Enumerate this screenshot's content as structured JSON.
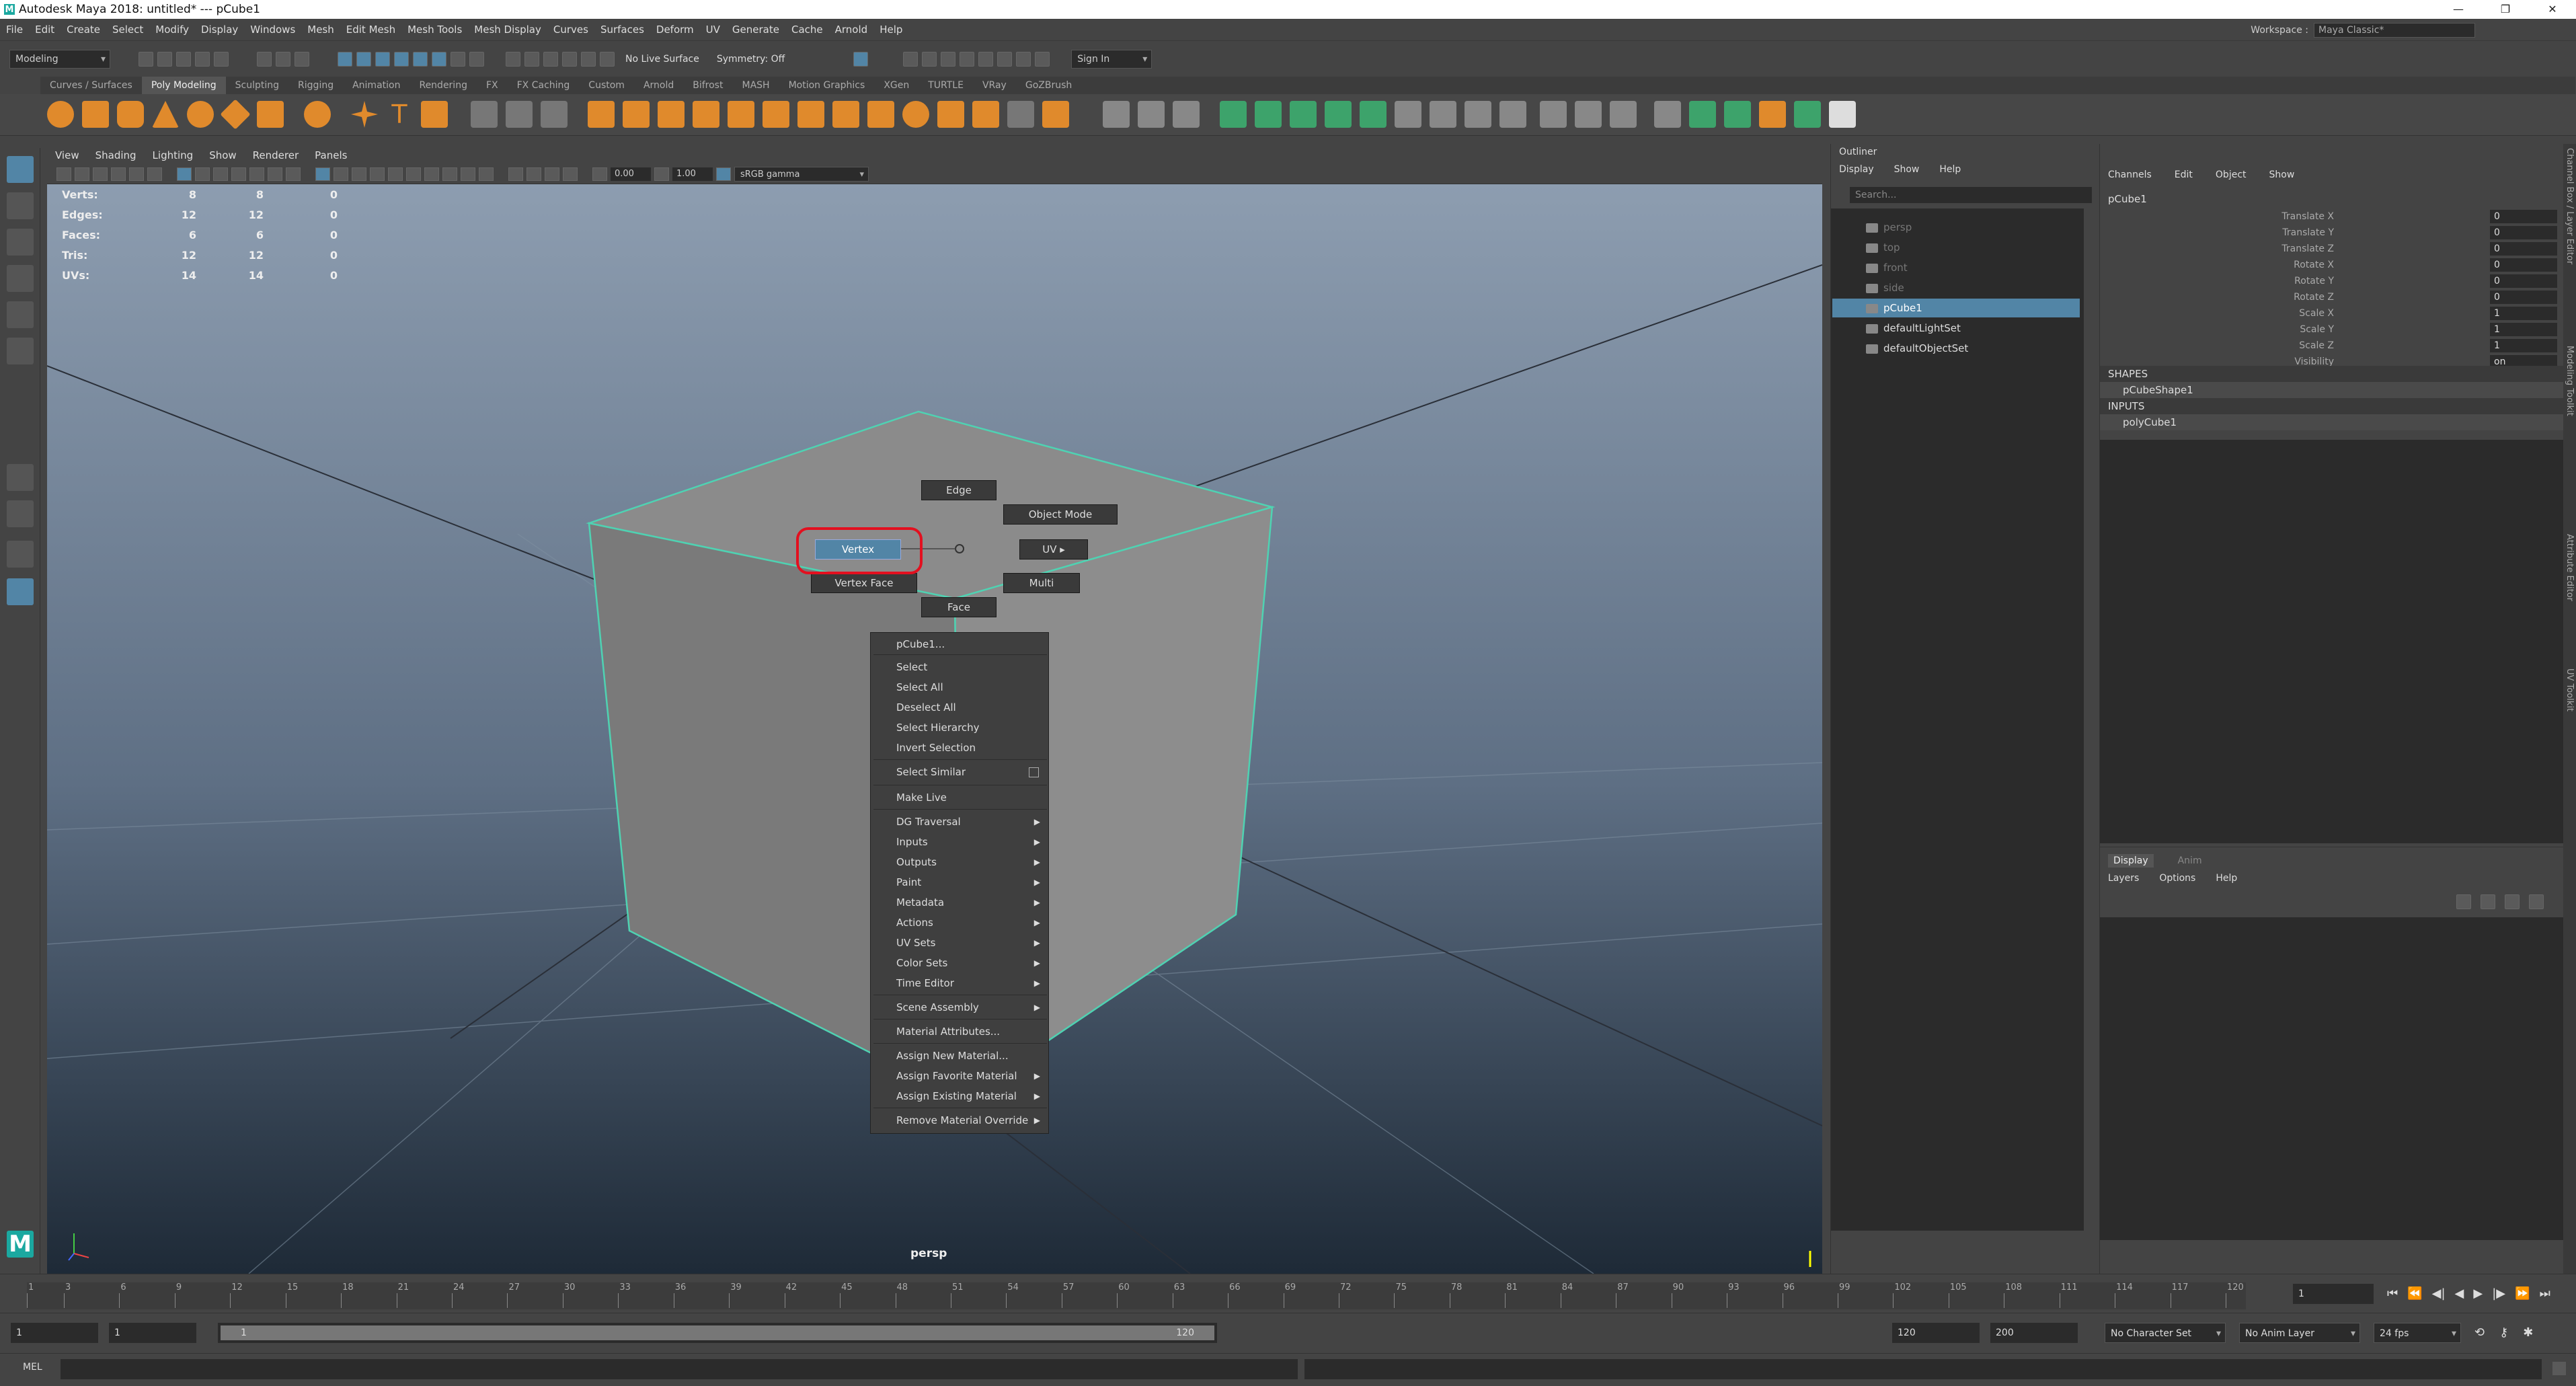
{
  "titlebar": {
    "title": "Autodesk Maya 2018: untitled*  ---  pCube1"
  },
  "menubar": {
    "items": [
      "File",
      "Edit",
      "Create",
      "Select",
      "Modify",
      "Display",
      "Windows",
      "Mesh",
      "Edit Mesh",
      "Mesh Tools",
      "Mesh Display",
      "Curves",
      "Surfaces",
      "Deform",
      "UV",
      "Generate",
      "Cache",
      "Arnold",
      "Help"
    ]
  },
  "workspace": {
    "label": "Workspace :",
    "value": "Maya Classic*"
  },
  "statusline": {
    "mode": "Modeling",
    "live_surface": "No Live Surface",
    "symmetry": "Symmetry: Off",
    "signin": "Sign In"
  },
  "shelf": {
    "tabs": [
      "Curves / Surfaces",
      "Poly Modeling",
      "Sculpting",
      "Rigging",
      "Animation",
      "Rendering",
      "FX",
      "FX Caching",
      "Custom",
      "Arnold",
      "Bifrost",
      "MASH",
      "Motion Graphics",
      "XGen",
      "TURTLE",
      "VRay",
      "GoZBrush"
    ],
    "active": "Poly Modeling"
  },
  "viewport": {
    "menu": [
      "View",
      "Shading",
      "Lighting",
      "Show",
      "Renderer",
      "Panels"
    ],
    "exposure": "0.00",
    "gamma_value": "1.00",
    "colorspace": "sRGB gamma",
    "camera_label": "persp",
    "hud": [
      {
        "label": "Verts:",
        "a": "8",
        "b": "8",
        "c": "0"
      },
      {
        "label": "Edges:",
        "a": "12",
        "b": "12",
        "c": "0"
      },
      {
        "label": "Faces:",
        "a": "6",
        "b": "6",
        "c": "0"
      },
      {
        "label": "Tris:",
        "a": "12",
        "b": "12",
        "c": "0"
      },
      {
        "label": "UVs:",
        "a": "14",
        "b": "14",
        "c": "0"
      }
    ]
  },
  "marking_menu": {
    "edge": "Edge",
    "object_mode": "Object Mode",
    "vertex": "Vertex",
    "uv": "UV",
    "vertex_face": "Vertex Face",
    "multi": "Multi",
    "face": "Face"
  },
  "context_menu": {
    "items": [
      {
        "label": "pCube1...",
        "sub": false
      },
      {
        "label": "Select",
        "sub": false
      },
      {
        "label": "Select All",
        "sub": false
      },
      {
        "label": "Deselect All",
        "sub": false
      },
      {
        "label": "Select Hierarchy",
        "sub": false
      },
      {
        "label": "Invert Selection",
        "sub": false
      },
      {
        "label": "Select Similar",
        "sub": false
      },
      {
        "label": "Make Live",
        "sub": false
      },
      {
        "label": "DG Traversal",
        "sub": true
      },
      {
        "label": "Inputs",
        "sub": true
      },
      {
        "label": "Outputs",
        "sub": true
      },
      {
        "label": "Paint",
        "sub": true
      },
      {
        "label": "Metadata",
        "sub": true
      },
      {
        "label": "Actions",
        "sub": true
      },
      {
        "label": "UV Sets",
        "sub": true
      },
      {
        "label": "Color Sets",
        "sub": true
      },
      {
        "label": "Time Editor",
        "sub": true
      },
      {
        "label": "Scene Assembly",
        "sub": true
      },
      {
        "label": "Material Attributes...",
        "sub": false
      },
      {
        "label": "Assign New Material...",
        "sub": false
      },
      {
        "label": "Assign Favorite Material",
        "sub": true
      },
      {
        "label": "Assign Existing Material",
        "sub": true
      },
      {
        "label": "Remove Material Override",
        "sub": true
      }
    ]
  },
  "outliner": {
    "title": "Outliner",
    "menu": [
      "Display",
      "Show",
      "Help"
    ],
    "search_placeholder": "Search...",
    "items": [
      {
        "label": "persp",
        "state": "dim"
      },
      {
        "label": "top",
        "state": "dim"
      },
      {
        "label": "front",
        "state": "dim"
      },
      {
        "label": "side",
        "state": "dim"
      },
      {
        "label": "pCube1",
        "state": "selected"
      },
      {
        "label": "defaultLightSet",
        "state": "normal"
      },
      {
        "label": "defaultObjectSet",
        "state": "normal"
      }
    ]
  },
  "channel_box": {
    "menu": [
      "Channels",
      "Edit",
      "Object",
      "Show"
    ],
    "object": "pCube1",
    "attrs": [
      {
        "label": "Translate X",
        "value": "0"
      },
      {
        "label": "Translate Y",
        "value": "0"
      },
      {
        "label": "Translate Z",
        "value": "0"
      },
      {
        "label": "Rotate X",
        "value": "0"
      },
      {
        "label": "Rotate Y",
        "value": "0"
      },
      {
        "label": "Rotate Z",
        "value": "0"
      },
      {
        "label": "Scale X",
        "value": "1"
      },
      {
        "label": "Scale Y",
        "value": "1"
      },
      {
        "label": "Scale Z",
        "value": "1"
      },
      {
        "label": "Visibility",
        "value": "on"
      }
    ],
    "shapes_header": "SHAPES",
    "shape": "pCubeShape1",
    "inputs_header": "INPUTS",
    "input": "polyCube1"
  },
  "layer_editor": {
    "tabs": [
      "Display",
      "Anim"
    ],
    "menu": [
      "Layers",
      "Options",
      "Help"
    ]
  },
  "side_tabs": [
    "Channel Box / Layer Editor",
    "Modeling Toolkit",
    "Attribute Editor",
    "UV Toolkit"
  ],
  "time_slider": {
    "ticks": [
      "1",
      "3",
      "6",
      "9",
      "12",
      "15",
      "18",
      "21",
      "24",
      "27",
      "30",
      "33",
      "36",
      "39",
      "42",
      "45",
      "48",
      "51",
      "54",
      "57",
      "60",
      "63",
      "66",
      "69",
      "72",
      "75",
      "78",
      "81",
      "84",
      "87",
      "90",
      "93",
      "96",
      "99",
      "102",
      "105",
      "108",
      "111",
      "114",
      "117",
      "120"
    ],
    "current": "1"
  },
  "range": {
    "start": "1",
    "start2": "1",
    "inner_start": "1",
    "inner_end": "120",
    "end": "120",
    "end2": "200",
    "character_set": "No Character Set",
    "anim_layer": "No Anim Layer",
    "fps": "24 fps"
  },
  "cmdline": {
    "label": "MEL"
  }
}
